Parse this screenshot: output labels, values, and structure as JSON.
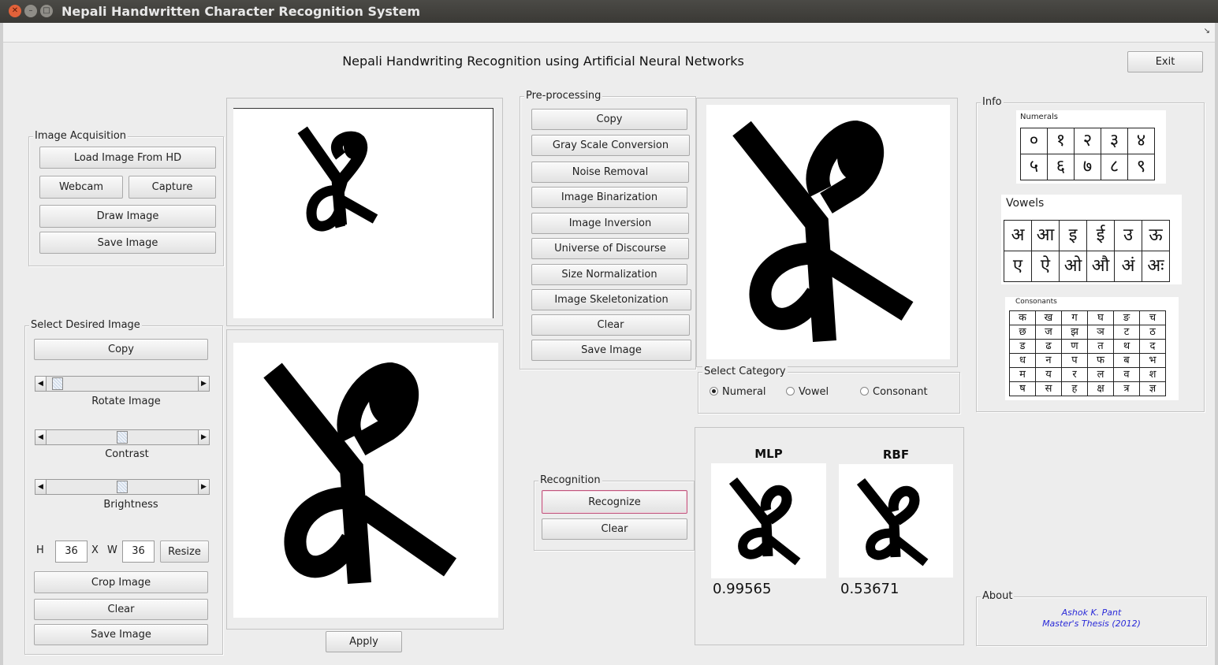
{
  "window": {
    "title": "Nepali Handwritten Character Recognition System"
  },
  "main": {
    "title": "Nepali Handwriting Recognition using Artificial Neural Networks",
    "exit_label": "Exit"
  },
  "acquisition": {
    "legend": "Image Acquisition",
    "load": "Load Image From HD",
    "webcam": "Webcam",
    "capture": "Capture",
    "draw": "Draw Image",
    "save": "Save Image"
  },
  "select_image": {
    "legend": "Select Desired Image",
    "copy": "Copy",
    "rotate_label": "Rotate Image",
    "contrast_label": "Contrast",
    "brightness_label": "Brightness",
    "rotate_value": 0.04,
    "contrast_value": 0.5,
    "brightness_value": 0.5,
    "h_label": "H",
    "x_label": "X",
    "w_label": "W",
    "h_value": "36",
    "w_value": "36",
    "resize": "Resize",
    "crop": "Crop Image",
    "clear": "Clear",
    "save": "Save Image"
  },
  "apply_label": "Apply",
  "preprocessing": {
    "legend": "Pre-processing",
    "buttons": [
      "Copy",
      "Gray Scale Conversion",
      "Noise Removal",
      "Image Binarization",
      "Image Inversion",
      "Universe of Discourse",
      "Size Normalization",
      "Image Skeletonization",
      "Clear",
      "Save Image"
    ]
  },
  "category": {
    "legend": "Select Category",
    "options": [
      "Numeral",
      "Vowel",
      "Consonant"
    ],
    "selected": "Numeral"
  },
  "recognition": {
    "legend": "Recognition",
    "recognize": "Recognize",
    "clear": "Clear"
  },
  "results": {
    "mlp_label": "MLP",
    "rbf_label": "RBF",
    "mlp_score": "0.99565",
    "rbf_score": "0.53671"
  },
  "info": {
    "legend": "Info",
    "numerals_caption": "Numerals",
    "numerals": [
      [
        "०",
        "१",
        "२",
        "३",
        "४"
      ],
      [
        "५",
        "६",
        "७",
        "८",
        "९"
      ]
    ],
    "vowels_caption": "Vowels",
    "vowels": [
      [
        "अ",
        "आ",
        "इ",
        "ई",
        "उ",
        "ऊ"
      ],
      [
        "ए",
        "ऐ",
        "ओ",
        "औ",
        "अं",
        "अः"
      ]
    ],
    "consonants_caption": "Consonants",
    "consonants": [
      [
        "क",
        "ख",
        "ग",
        "घ",
        "ङ",
        "च"
      ],
      [
        "छ",
        "ज",
        "झ",
        "ञ",
        "ट",
        "ठ"
      ],
      [
        "ड",
        "ढ",
        "ण",
        "त",
        "थ",
        "द"
      ],
      [
        "ध",
        "न",
        "प",
        "फ",
        "ब",
        "भ"
      ],
      [
        "म",
        "य",
        "र",
        "ल",
        "व",
        "श"
      ],
      [
        "ष",
        "स",
        "ह",
        "क्ष",
        "त्र",
        "ज्ञ"
      ]
    ]
  },
  "about": {
    "legend": "About",
    "author": "Ashok K. Pant",
    "thesis": "Master's Thesis (2012)"
  },
  "colors": {
    "accent_focus": "#c0567e",
    "about_text": "#2a2ad8",
    "titlebar": "#3c3b37"
  }
}
